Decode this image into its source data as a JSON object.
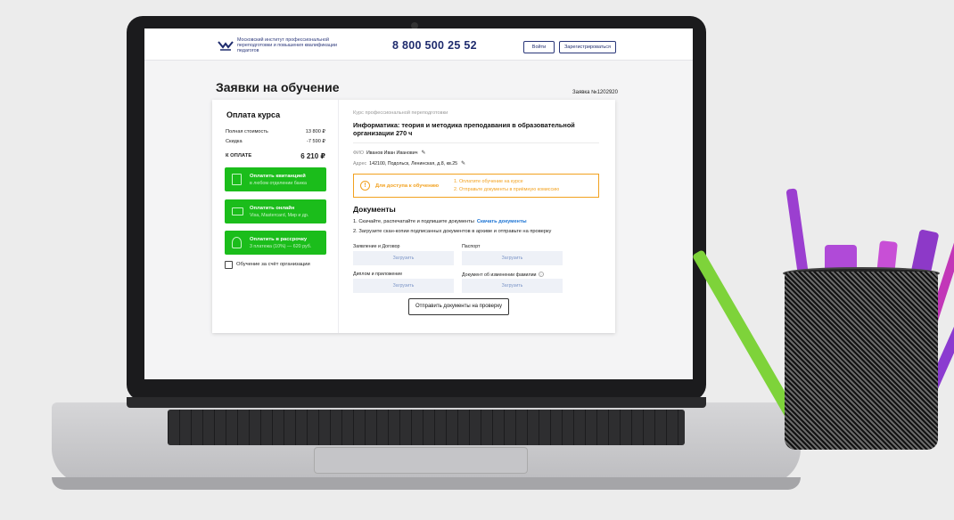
{
  "header": {
    "logo_text": "Московский институт профессиональной переподготовки и повышения квалификации педагогов",
    "phone": "8 800 500 25 52",
    "login_label": "Войти",
    "register_label": "Зарегистрироваться"
  },
  "page": {
    "title": "Заявки на обучение",
    "application_number": "Заявка №1202920"
  },
  "payment": {
    "title": "Оплата курса",
    "full_price_label": "Полная стоимость",
    "full_price": "13 800 ₽",
    "discount_label": "Скидка",
    "discount": "-7 590 ₽",
    "total_label": "К ОПЛАТЕ",
    "total": "6 210 ₽",
    "buttons": [
      {
        "title": "Оплатить квитанцией",
        "subtitle": "в любом отделении банка",
        "icon": "receipt-icon"
      },
      {
        "title": "Оплатить онлайн",
        "subtitle": "Visa, Mastercard, Мир и др.",
        "icon": "card-icon"
      },
      {
        "title": "Оплатить в рассрочку",
        "subtitle": "3 платежа (10%) — 620 руб.",
        "icon": "installment-icon"
      }
    ],
    "org_checkbox_label": "Обучение за счёт организации",
    "org_checkbox_checked": false
  },
  "course": {
    "type": "Курс профессиональной переподготовки",
    "name": "Информатика: теория и методика преподавания в образовательной организации 270 ч",
    "fio_label": "ФИО",
    "fio": "Иванов Иван Иванович",
    "address_label": "Адрес",
    "address": "142100, Подольск, Ленинская, д.8, кв.25"
  },
  "notice": {
    "label": "Для доступа к обучению",
    "steps": [
      "1. Оплатите обучение на курсе",
      "2. Отправьте документы в приёмную комиссию"
    ],
    "accent_color": "#f2a11f"
  },
  "documents": {
    "title": "Документы",
    "step1": "1. Скачайте, распечатайте и подпишите документы",
    "download_link": "Скачать документы",
    "step2": "2. Загрузите скан-копии подписанных документов в архиве и отправьте на проверку",
    "uploads": [
      {
        "label": "Заявление и Договор",
        "button": "Загрузить"
      },
      {
        "label": "Паспорт",
        "button": "Загрузить"
      },
      {
        "label": "Диплом и приложение",
        "button": "Загрузить"
      },
      {
        "label": "Документ об изменении фамилии",
        "button": "Загрузить"
      }
    ],
    "submit_label": "Отправить документы на проверку"
  },
  "colors": {
    "brand": "#1f2c6e",
    "green": "#1bbd1b",
    "link": "#1c74d4"
  }
}
